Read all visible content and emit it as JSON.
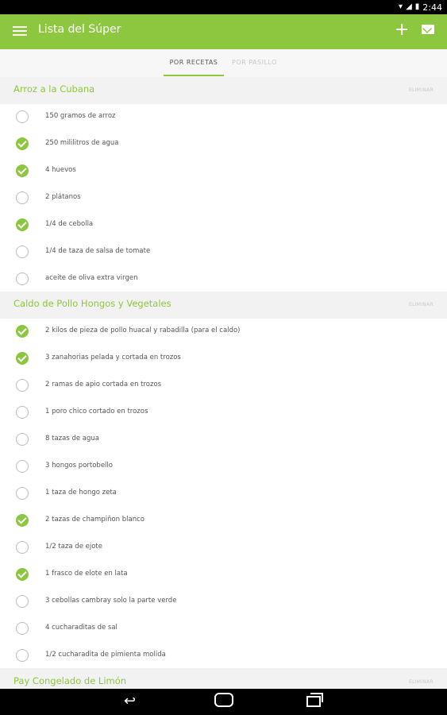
{
  "status_bar": {
    "time": "2:44",
    "icons": [
      "wifi-icon",
      "signal-icon",
      "battery-icon"
    ]
  },
  "app_bar": {
    "title": "Lista del Súper",
    "add_label": "+",
    "menu_icon": "hamburger-menu-icon",
    "mail_icon": "mail-icon"
  },
  "tabs": [
    {
      "label": "POR RECETAS",
      "active": true
    },
    {
      "label": "POR PASILLO",
      "active": false
    }
  ],
  "colors": {
    "accent": "#8dc63f",
    "header_bg": "#f2f2f2",
    "text": "#555555"
  },
  "recipes": [
    {
      "name": "Arroz a la Cubana",
      "delete_label": "ELIMINAR",
      "items": [
        {
          "label": "150 gramos de arroz",
          "checked": false
        },
        {
          "label": "250 mililitros de agua",
          "checked": true
        },
        {
          "label": "4 huevos",
          "checked": true
        },
        {
          "label": "2 plátanos",
          "checked": false
        },
        {
          "label": "1/4 de cebolla",
          "checked": true
        },
        {
          "label": "1/4 de taza de salsa de tomate",
          "checked": false
        },
        {
          "label": "aceite de oliva extra virgen",
          "checked": false
        }
      ]
    },
    {
      "name": "Caldo de Pollo Hongos y Vegetales",
      "delete_label": "ELIMINAR",
      "items": [
        {
          "label": "2 kilos de pieza de pollo huacal y rabadilla (para el caldo)",
          "checked": true
        },
        {
          "label": "3 zanahorias pelada y cortada en trozos",
          "checked": true
        },
        {
          "label": "2 ramas de apio cortada en trozos",
          "checked": false
        },
        {
          "label": "1 poro chico cortado en trozos",
          "checked": false
        },
        {
          "label": "8 tazas de agua",
          "checked": false
        },
        {
          "label": "3 hongos portobello",
          "checked": false
        },
        {
          "label": "1 taza de hongo zeta",
          "checked": false
        },
        {
          "label": "2 tazas de champiñon blanco",
          "checked": true
        },
        {
          "label": "1/2 taza de ejote",
          "checked": false
        },
        {
          "label": "1 frasco de elote en lata",
          "checked": true
        },
        {
          "label": "3 cebollas cambray solo la parte verde",
          "checked": false
        },
        {
          "label": "4 cucharaditas de sal",
          "checked": false
        },
        {
          "label": "1/2 cucharadita de pimienta molida",
          "checked": false
        }
      ]
    },
    {
      "name": "Pay Congelado de Limón",
      "delete_label": "ELIMINAR",
      "items": []
    }
  ],
  "nav_bar": {
    "icons": [
      "back-icon",
      "home-icon",
      "recent-apps-icon"
    ]
  }
}
